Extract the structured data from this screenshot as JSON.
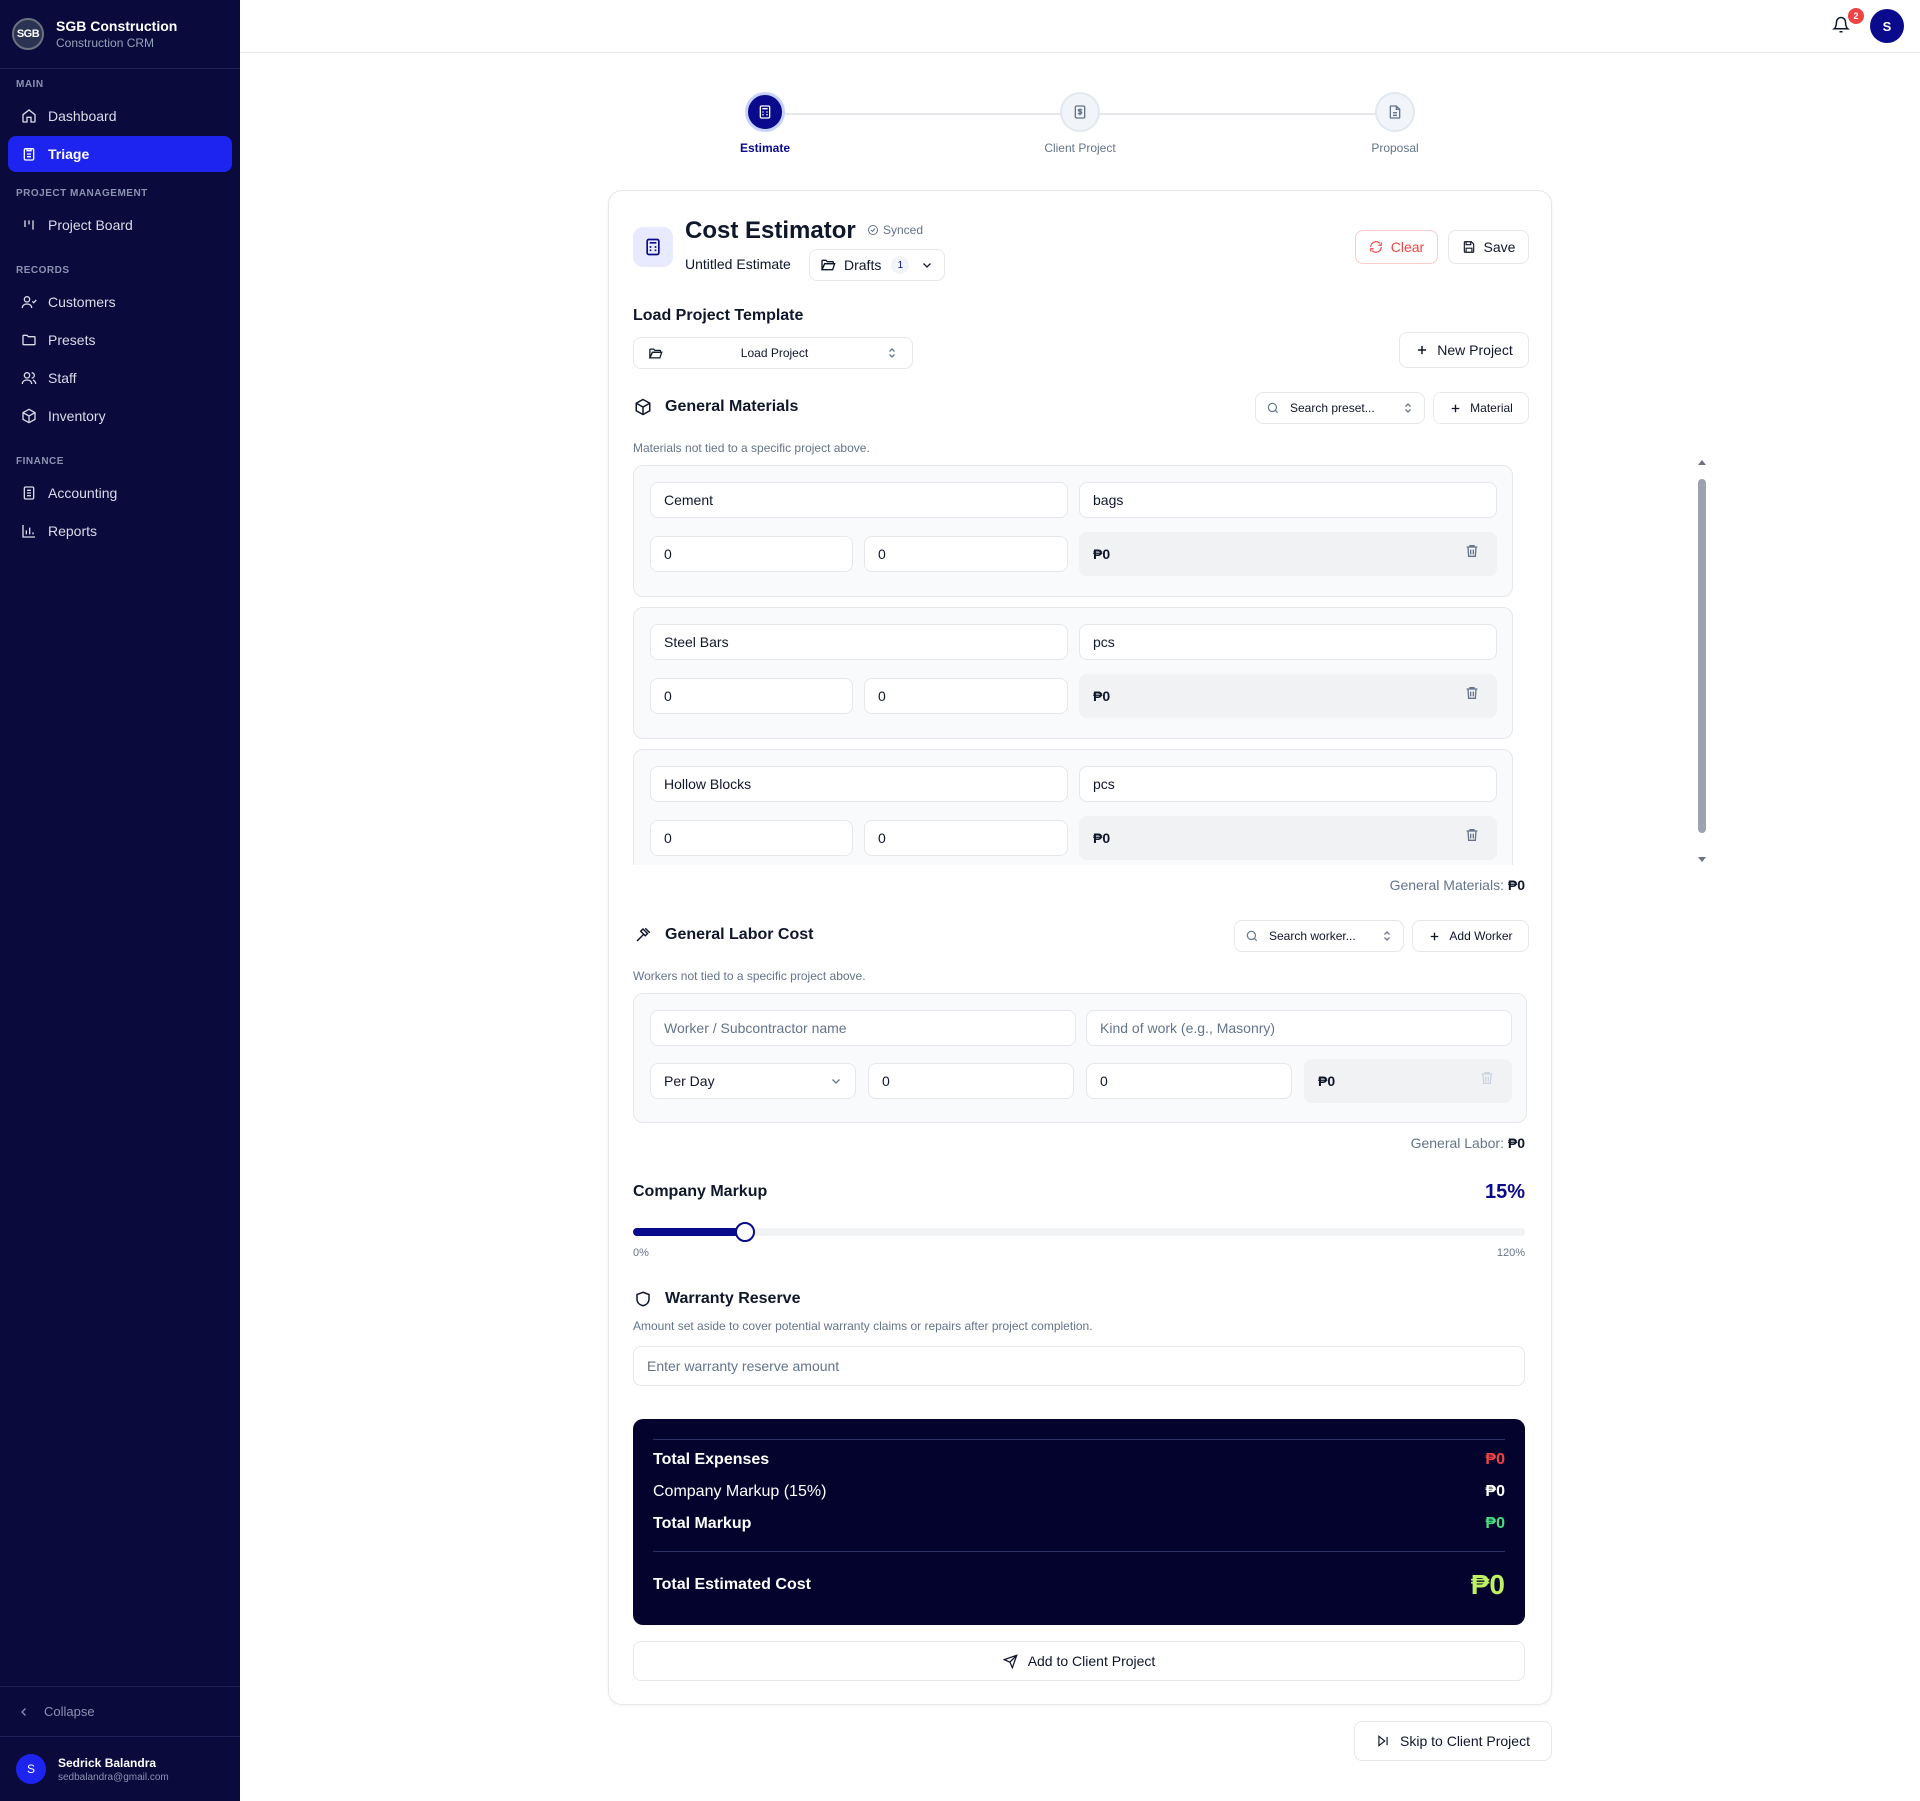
{
  "brand": {
    "name": "SGB Construction",
    "subtitle": "Construction CRM",
    "logo_text": "SGB"
  },
  "sidebar": {
    "sections": [
      {
        "title": "MAIN",
        "items": [
          {
            "label": "Dashboard",
            "icon": "home-icon"
          },
          {
            "label": "Triage",
            "icon": "clipboard-icon",
            "active": true
          }
        ]
      },
      {
        "title": "PROJECT MANAGEMENT",
        "items": [
          {
            "label": "Project Board",
            "icon": "kanban-icon"
          }
        ]
      },
      {
        "title": "RECORDS",
        "items": [
          {
            "label": "Customers",
            "icon": "users-icon"
          },
          {
            "label": "Presets",
            "icon": "folder-icon"
          },
          {
            "label": "Staff",
            "icon": "staff-icon"
          },
          {
            "label": "Inventory",
            "icon": "package-icon"
          }
        ]
      },
      {
        "title": "FINANCE",
        "items": [
          {
            "label": "Accounting",
            "icon": "ledger-icon"
          },
          {
            "label": "Reports",
            "icon": "bar-chart-icon"
          }
        ]
      }
    ],
    "collapse_label": "Collapse",
    "user": {
      "initial": "S",
      "name": "Sedrick Balandra",
      "email": "sedbalandra@gmail.com"
    }
  },
  "topbar": {
    "notification_count": "2",
    "avatar_initial": "S"
  },
  "stepper": {
    "steps": [
      {
        "label": "Estimate",
        "active": true
      },
      {
        "label": "Client Project"
      },
      {
        "label": "Proposal"
      }
    ]
  },
  "estimator": {
    "title": "Cost Estimator",
    "sync_status": "Synced",
    "estimate_name": "Untitled Estimate",
    "drafts_label": "Drafts",
    "drafts_count": "1",
    "clear_label": "Clear",
    "save_label": "Save"
  },
  "template": {
    "label": "Load Project Template",
    "load_label": "Load Project",
    "new_project_label": "New Project"
  },
  "materials": {
    "title": "General Materials",
    "hint": "Materials not tied to a specific project above.",
    "search_placeholder": "Search preset...",
    "add_label": "Material",
    "items": [
      {
        "name": "Cement",
        "unit": "bags",
        "qty": "0",
        "price": "0",
        "total": "₱0"
      },
      {
        "name": "Steel Bars",
        "unit": "pcs",
        "qty": "0",
        "price": "0",
        "total": "₱0"
      },
      {
        "name": "Hollow Blocks",
        "unit": "pcs",
        "qty": "0",
        "price": "0",
        "total": "₱0"
      }
    ],
    "subtotal_label": "General Materials:",
    "subtotal_value": "₱0"
  },
  "labor": {
    "title": "General Labor Cost",
    "hint": "Workers not tied to a specific project above.",
    "search_placeholder": "Search worker...",
    "add_label": "Add Worker",
    "name_placeholder": "Worker / Subcontractor name",
    "work_placeholder": "Kind of work (e.g., Masonry)",
    "rate_type": "Per Day",
    "rate": "0",
    "days": "0",
    "total": "₱0",
    "subtotal_label": "General Labor:",
    "subtotal_value": "₱0"
  },
  "markup": {
    "label": "Company Markup",
    "value_label": "15%",
    "value": 15,
    "min": 0,
    "max": 120,
    "min_label": "0%",
    "max_label": "120%"
  },
  "warranty": {
    "title": "Warranty Reserve",
    "hint": "Amount set aside to cover potential warranty claims or repairs after project completion.",
    "placeholder": "Enter warranty reserve amount"
  },
  "summary": {
    "total_expenses_label": "Total Expenses",
    "total_expenses_value": "₱0",
    "company_markup_label": "Company Markup (15%)",
    "company_markup_value": "₱0",
    "total_markup_label": "Total Markup",
    "total_markup_value": "₱0",
    "total_estimated_label": "Total Estimated Cost",
    "total_estimated_value": "₱0",
    "colors": {
      "expenses": "#ef4444",
      "markup": "#ffffff",
      "total_markup": "#4ade80",
      "estimated": "#bef264"
    }
  },
  "actions": {
    "add_to_client_label": "Add to Client Project",
    "skip_label": "Skip to Client Project"
  }
}
